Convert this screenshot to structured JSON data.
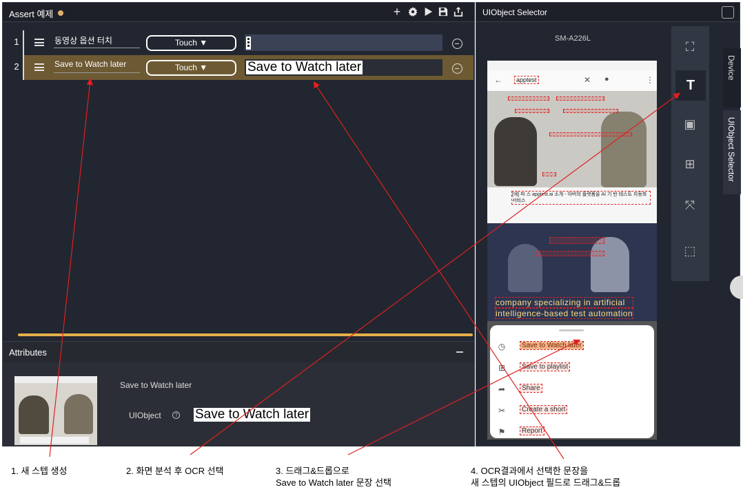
{
  "left_panel": {
    "title": "Assert 예제",
    "toolbar": [
      "add-icon",
      "gear-icon",
      "play-icon",
      "save-icon",
      "export-icon"
    ],
    "steps": [
      {
        "num": "1",
        "label": "동영상 옵션 터치",
        "action": "Touch ▼",
        "value": ""
      },
      {
        "num": "2",
        "label": "Save to Watch later",
        "action": "Touch ▼",
        "value": "Save to Watch later"
      }
    ]
  },
  "attributes": {
    "title": "Attributes",
    "name": "Save to Watch later",
    "uiobject_label": "UIObject",
    "help_icon": "?",
    "uiobject_value": "Save to Watch later"
  },
  "right_panel": {
    "title": "UIObject Selector",
    "device_model": "SM-A226L",
    "tabs": [
      "Device",
      "UIObject Selector"
    ],
    "phone": {
      "search_text": "apptest",
      "info_line": "[에] 파 스 apptest.ai 소개 - 아버의 플랫폼을 AI 기 반 테스트 자동화 서비스",
      "overlay_line1": "company specializing in artificial",
      "overlay_line2": "intelligence-based test automation",
      "sheet_items": [
        "Save to Watch later",
        "Save to playlist",
        "Share",
        "Create a short",
        "Report"
      ]
    },
    "tools": [
      "select-icon",
      "ocr-icon",
      "image-icon",
      "grid-icon",
      "expand-icon",
      "crop-icon"
    ]
  },
  "captions": {
    "c1": "1. 새 스텝 생성",
    "c2": "2. 화면 분석 후 OCR 선택",
    "c3a": "3. 드래그&드롭으로",
    "c3b": "Save to Watch later 문장 선택",
    "c4a": "4. OCR결과에서 선택한 문장을",
    "c4b": "새 스텝의 UIObject 필드로 드래그&드롭"
  },
  "colors": {
    "panel_bg": "#222630",
    "selected_row": "#6d5a33",
    "progress": "#e5b04a",
    "annotation_red": "#e02020"
  }
}
